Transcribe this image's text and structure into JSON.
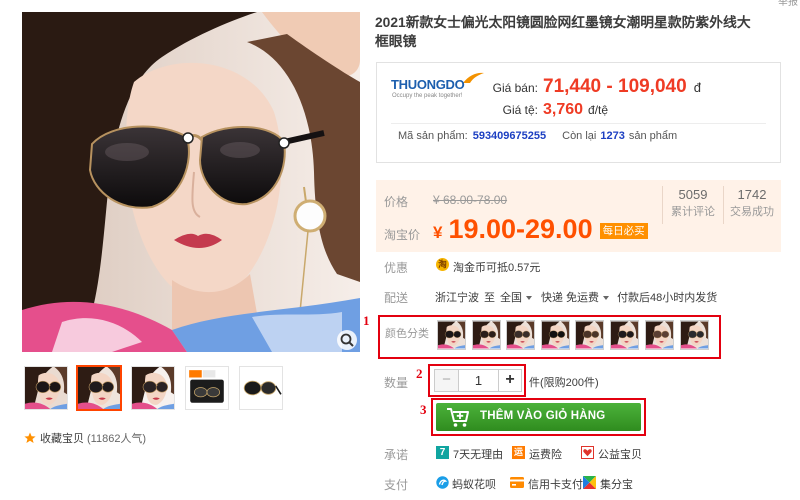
{
  "page": {
    "report_fragment": "举报"
  },
  "product": {
    "title_line1": "2021新款女士偏光太阳镜圆脸网红墨镜女潮明星款防紫外线大",
    "title_line2": "框眼镜"
  },
  "favorite": {
    "icon": "star-icon",
    "label": "收藏宝贝",
    "count": "(11862人气)"
  },
  "thuongdo": {
    "logo_name": "THUONGDO",
    "logo_tagline": "Occupy the peak together!",
    "sell_label": "Giá bán:",
    "sell_value": "71,440 - 109,040",
    "sell_unit": "đ",
    "rate_label": "Giá tệ:",
    "rate_value": "3,760",
    "rate_unit": "đ/tệ",
    "code_label": "Mã sản phẩm:",
    "code_value": "593409675255",
    "stock_prefix": "Còn lại",
    "stock_value": "1273",
    "stock_suffix": "sản phẩm"
  },
  "taobao": {
    "price_label": "价格",
    "orig_price": "¥ 68.00-78.00",
    "promo_label": "淘宝价",
    "currency": "¥",
    "promo_price": "19.00-29.00",
    "badge": "每日必买",
    "reviews_value": "5059",
    "reviews_label": "累计评论",
    "sales_value": "1742",
    "sales_label": "交易成功"
  },
  "promo": {
    "label": "优惠",
    "icon": "taojinbi-icon",
    "icon_glyph": "淘",
    "text": "淘金币可抵0.57元"
  },
  "delivery": {
    "label": "配送",
    "from": "浙江宁波",
    "sep": "至",
    "to": "全国",
    "method": "快递 免运费",
    "time": "付款后48小时内发货"
  },
  "color": {
    "label": "颜色分类"
  },
  "quantity": {
    "label": "数量",
    "minus": "−",
    "value": "1",
    "plus": "+",
    "unit": "件(限购200件)"
  },
  "cart": {
    "label": "THÊM VÀO GIỎ HÀNG",
    "icon": "add-to-cart-icon"
  },
  "promise": {
    "label": "承诺",
    "items": [
      {
        "icon": "seven-day-return-icon",
        "glyph": "7",
        "text": "7天无理由"
      },
      {
        "icon": "shipping-insurance-icon",
        "glyph": "运",
        "text": "运费险"
      },
      {
        "icon": "charity-icon",
        "text": "公益宝贝"
      }
    ]
  },
  "payment": {
    "label": "支付",
    "items": [
      {
        "icon": "huabei-icon",
        "text": "蚂蚁花呗"
      },
      {
        "icon": "credit-card-icon",
        "text": "信用卡支付"
      },
      {
        "icon": "jifenbao-icon",
        "text": "集分宝"
      }
    ]
  },
  "annotations": {
    "marker_1": "1",
    "marker_2": "2",
    "marker_3": "3"
  },
  "colors": {
    "taobao_orange": "#ff5000",
    "price_red": "#ef3b24",
    "cart_green": "#3a9e2a",
    "annotation_red": "#e3000f",
    "link_blue": "#1c3fc2",
    "panel_peach": "#fff2e8"
  }
}
